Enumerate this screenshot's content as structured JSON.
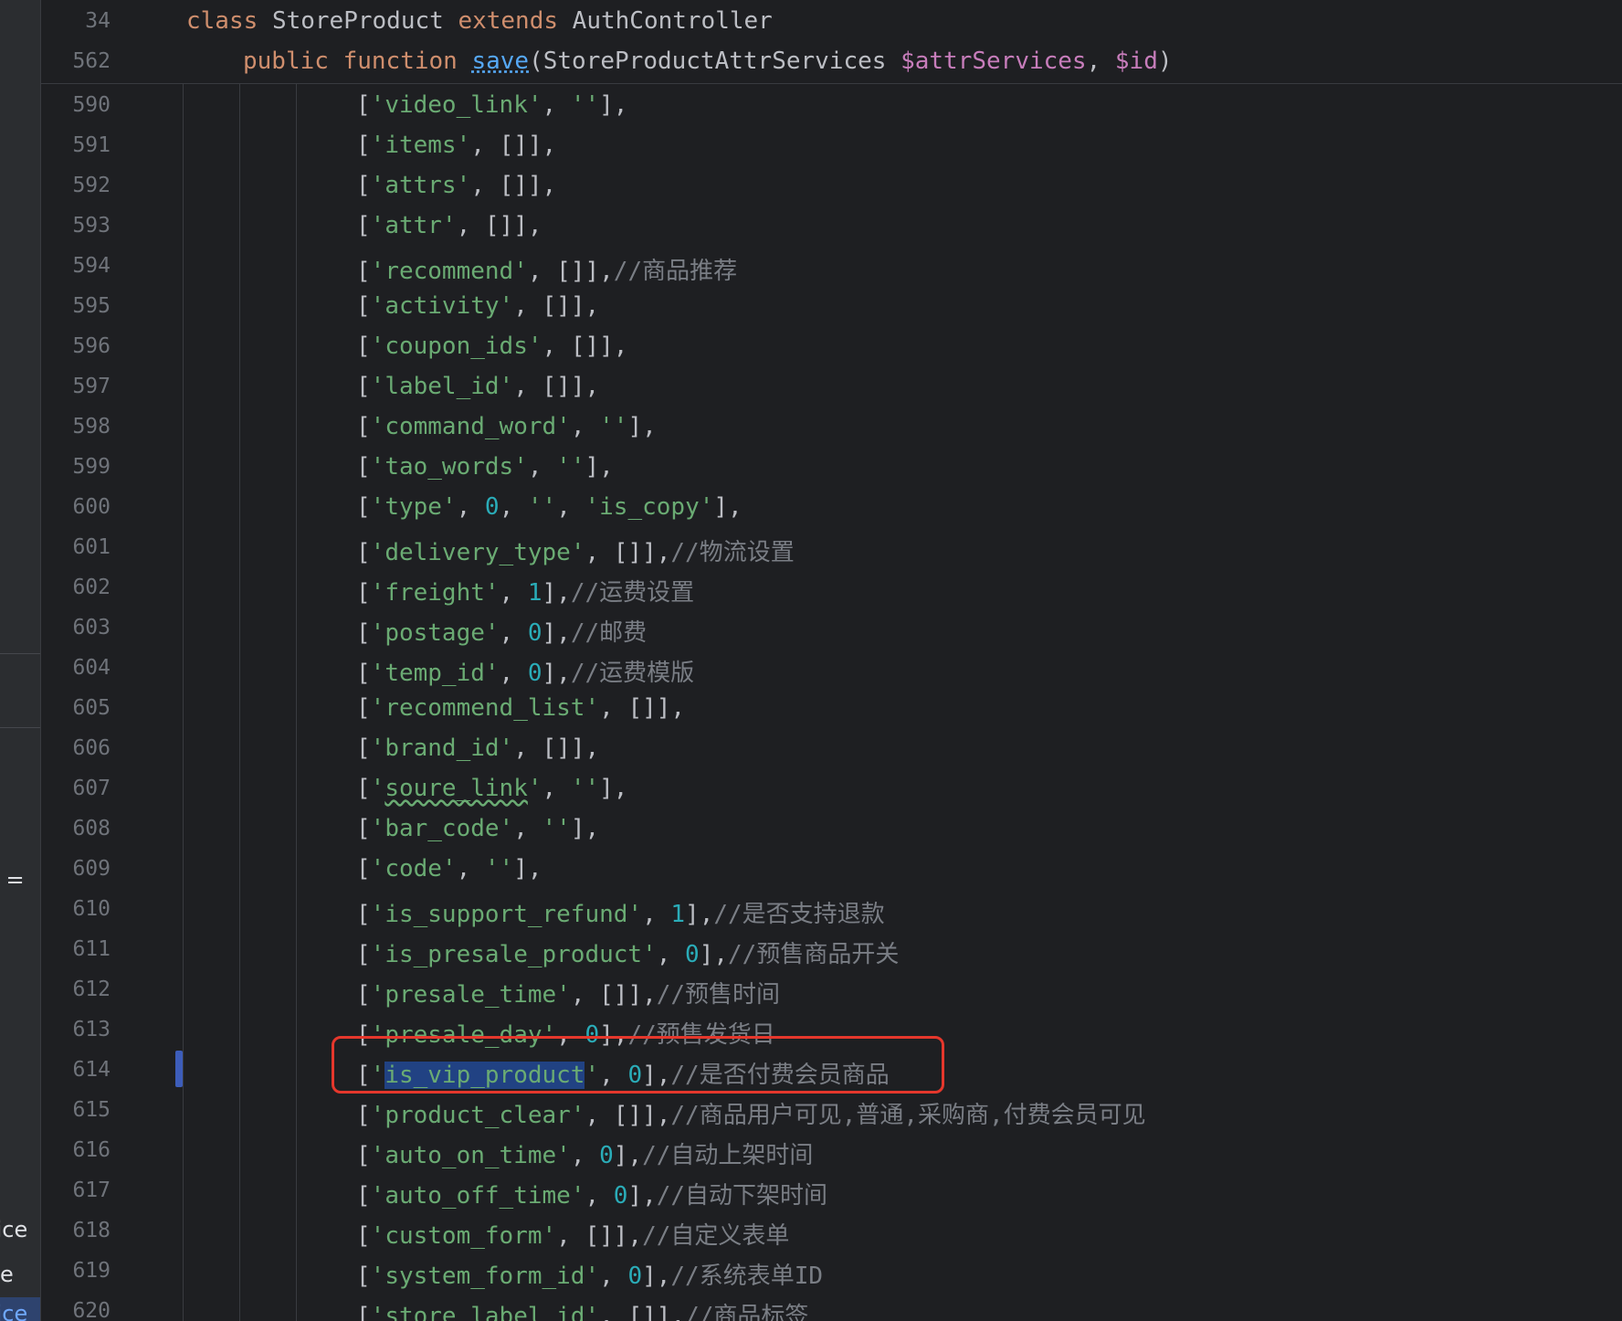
{
  "sticky": {
    "line1": {
      "num": "34",
      "kw_class": "class",
      "name": "StoreProduct",
      "kw_extends": "extends",
      "parent": "AuthController"
    },
    "line2": {
      "num": "562",
      "kw_public": "public",
      "kw_function": "function",
      "fn": "save",
      "open": "(",
      "type": "StoreProductAttrServices",
      "arg1": "$attrServices",
      "comma": ", ",
      "arg2": "$id",
      "close": ")"
    }
  },
  "side_fragments": [
    "g =",
    "vice",
    "e",
    "vice"
  ],
  "lines": [
    {
      "num": "590",
      "key": "video_link",
      "val_type": "str",
      "val": "''",
      "comment": ""
    },
    {
      "num": "591",
      "key": "items",
      "val_type": "pun",
      "val": "[]",
      "comment": ""
    },
    {
      "num": "592",
      "key": "attrs",
      "val_type": "pun",
      "val": "[]",
      "comment": ""
    },
    {
      "num": "593",
      "key": "attr",
      "val_type": "pun",
      "val": "[]",
      "comment": ""
    },
    {
      "num": "594",
      "key": "recommend",
      "val_type": "pun",
      "val": "[]",
      "comment": "//商品推荐"
    },
    {
      "num": "595",
      "key": "activity",
      "val_type": "pun",
      "val": "[]",
      "comment": ""
    },
    {
      "num": "596",
      "key": "coupon_ids",
      "val_type": "pun",
      "val": "[]",
      "comment": ""
    },
    {
      "num": "597",
      "key": "label_id",
      "val_type": "pun",
      "val": "[]",
      "comment": ""
    },
    {
      "num": "598",
      "key": "command_word",
      "val_type": "str",
      "val": "''",
      "comment": ""
    },
    {
      "num": "599",
      "key": "tao_words",
      "val_type": "str",
      "val": "''",
      "comment": ""
    },
    {
      "num": "600",
      "key": "type",
      "val_type": "special",
      "val": "",
      "comment": ""
    },
    {
      "num": "601",
      "key": "delivery_type",
      "val_type": "pun",
      "val": "[]",
      "comment": "//物流设置"
    },
    {
      "num": "602",
      "key": "freight",
      "val_type": "num",
      "val": "1",
      "comment": "//运费设置"
    },
    {
      "num": "603",
      "key": "postage",
      "val_type": "num",
      "val": "0",
      "comment": "//邮费"
    },
    {
      "num": "604",
      "key": "temp_id",
      "val_type": "num",
      "val": "0",
      "comment": "//运费模版"
    },
    {
      "num": "605",
      "key": "recommend_list",
      "val_type": "pun",
      "val": "[]",
      "comment": ""
    },
    {
      "num": "606",
      "key": "brand_id",
      "val_type": "pun",
      "val": "[]",
      "comment": ""
    },
    {
      "num": "607",
      "key": "soure_link",
      "val_type": "str",
      "val": "''",
      "comment": ""
    },
    {
      "num": "608",
      "key": "bar_code",
      "val_type": "str",
      "val": "''",
      "comment": ""
    },
    {
      "num": "609",
      "key": "code",
      "val_type": "str",
      "val": "''",
      "comment": ""
    },
    {
      "num": "610",
      "key": "is_support_refund",
      "val_type": "num",
      "val": "1",
      "comment": "//是否支持退款"
    },
    {
      "num": "611",
      "key": "is_presale_product",
      "val_type": "num",
      "val": "0",
      "comment": "//预售商品开关"
    },
    {
      "num": "612",
      "key": "presale_time",
      "val_type": "pun",
      "val": "[]",
      "comment": "//预售时间"
    },
    {
      "num": "613",
      "key": "presale_day",
      "val_type": "num",
      "val": "0",
      "comment": "//预售发货日"
    },
    {
      "num": "614",
      "key": "is_vip_product",
      "val_type": "num",
      "val": "0",
      "comment": "//是否付费会员商品"
    },
    {
      "num": "615",
      "key": "product_clear",
      "val_type": "pun",
      "val": "[]",
      "comment": "//商品用户可见,普通,采购商,付费会员可见"
    },
    {
      "num": "616",
      "key": "auto_on_time",
      "val_type": "num",
      "val": "0",
      "comment": "//自动上架时间"
    },
    {
      "num": "617",
      "key": "auto_off_time",
      "val_type": "num",
      "val": "0",
      "comment": "//自动下架时间"
    },
    {
      "num": "618",
      "key": "custom_form",
      "val_type": "pun",
      "val": "[]",
      "comment": "//自定义表单"
    },
    {
      "num": "619",
      "key": "system_form_id",
      "val_type": "num",
      "val": "0",
      "comment": "//系统表单ID"
    },
    {
      "num": "620",
      "key": "store_label_id",
      "val_type": "pun",
      "val": "[]",
      "comment": "//商品标签"
    }
  ],
  "line600": {
    "v1": "0",
    "v2": "''",
    "v3": "'is_copy'"
  },
  "colors": {
    "background": "#1e1f22",
    "keyword": "#cf8e6d",
    "string": "#6aab73",
    "number": "#2aacb8",
    "comment": "#7a7e85",
    "highlight": "#e5372c"
  }
}
